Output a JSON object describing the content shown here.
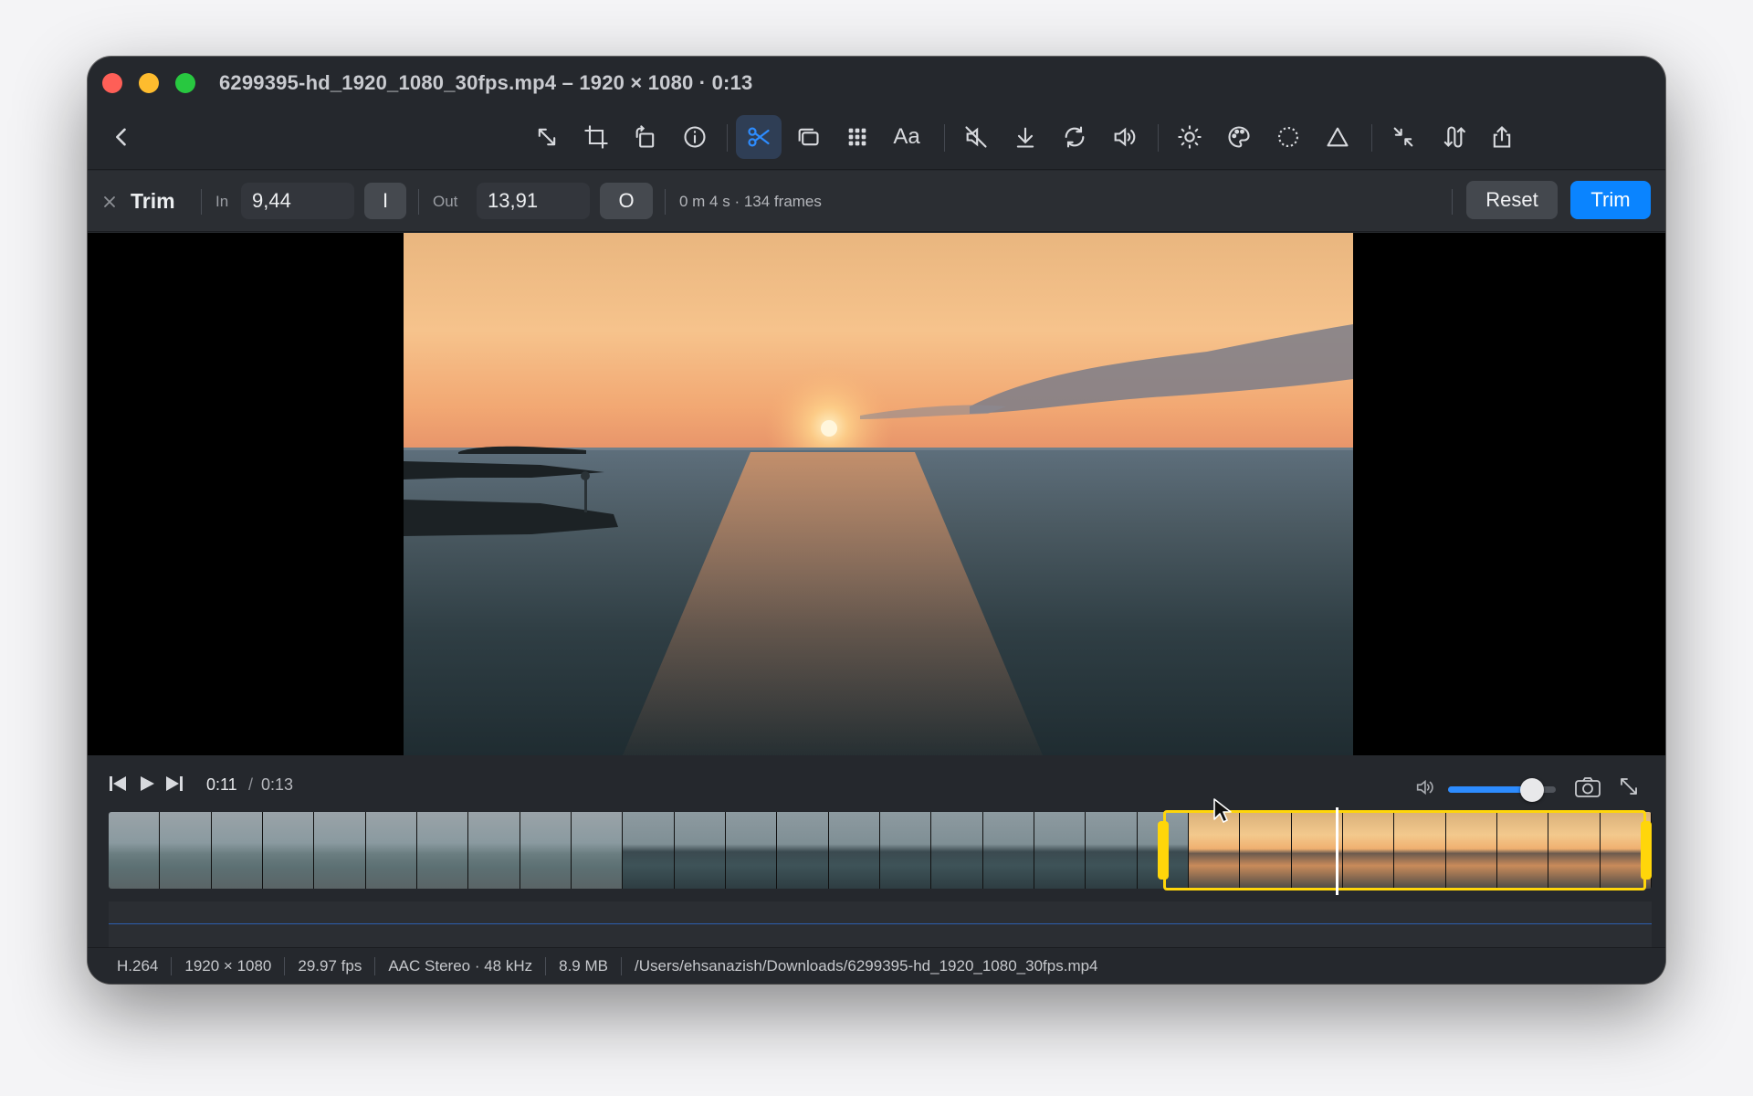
{
  "window": {
    "title": "6299395-hd_1920_1080_30fps.mp4 – 1920 × 1080 · 0:13"
  },
  "trim": {
    "label": "Trim",
    "in_label": "In",
    "in_value": "9,44",
    "in_key": "I",
    "out_label": "Out",
    "out_value": "13,91",
    "out_key": "O",
    "duration_info": "0 m 4 s · 134 frames",
    "reset_label": "Reset",
    "trim_label": "Trim"
  },
  "toolbar": {
    "text_tool_label": "Aa",
    "active_tool": "scissors-icon"
  },
  "player": {
    "current_time": "0:11",
    "separator": "/",
    "total_time": "0:13",
    "volume_level": 0.78,
    "selection_start_fraction": 0.68,
    "selection_end_fraction": 1.0,
    "playhead_fraction": 0.795
  },
  "status": {
    "codec": "H.264",
    "resolution": "1920 × 1080",
    "fps": "29.97 fps",
    "audio": "AAC Stereo · 48 kHz",
    "size": "8.9 MB",
    "path": "/Users/ehsanazish/Downloads/6299395-hd_1920_1080_30fps.mp4"
  },
  "colors": {
    "accent": "#0a84ff",
    "selection": "#ffd60a",
    "window_bg": "#25282d"
  }
}
